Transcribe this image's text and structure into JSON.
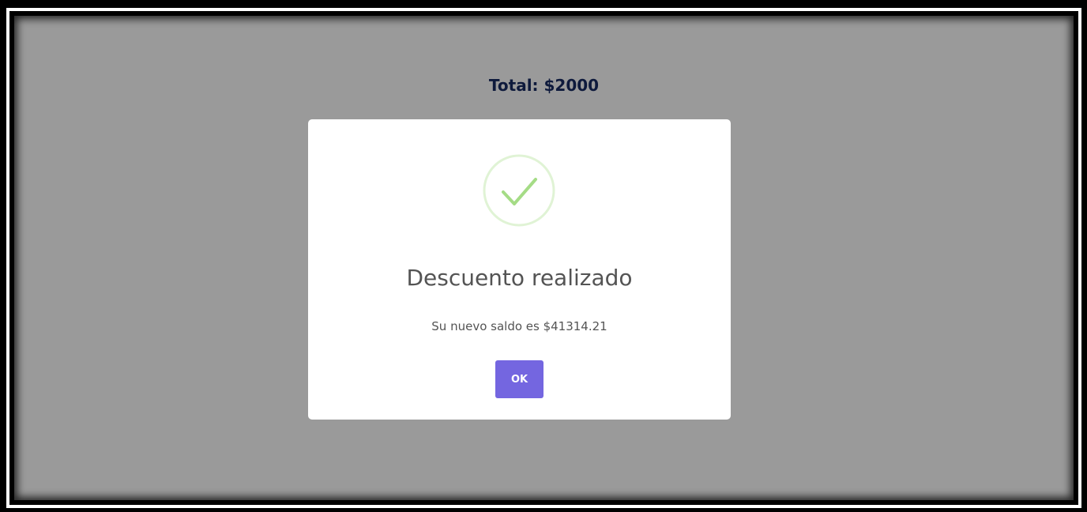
{
  "page": {
    "total_text": "Total: $2000"
  },
  "dialog": {
    "icon": "checkmark-circle-icon",
    "icon_color": "#a5dc86",
    "title": "Descuento realizado",
    "message": "Su nuevo saldo es $41314.21",
    "confirm_label": "OK",
    "confirm_color": "#7466e0"
  }
}
